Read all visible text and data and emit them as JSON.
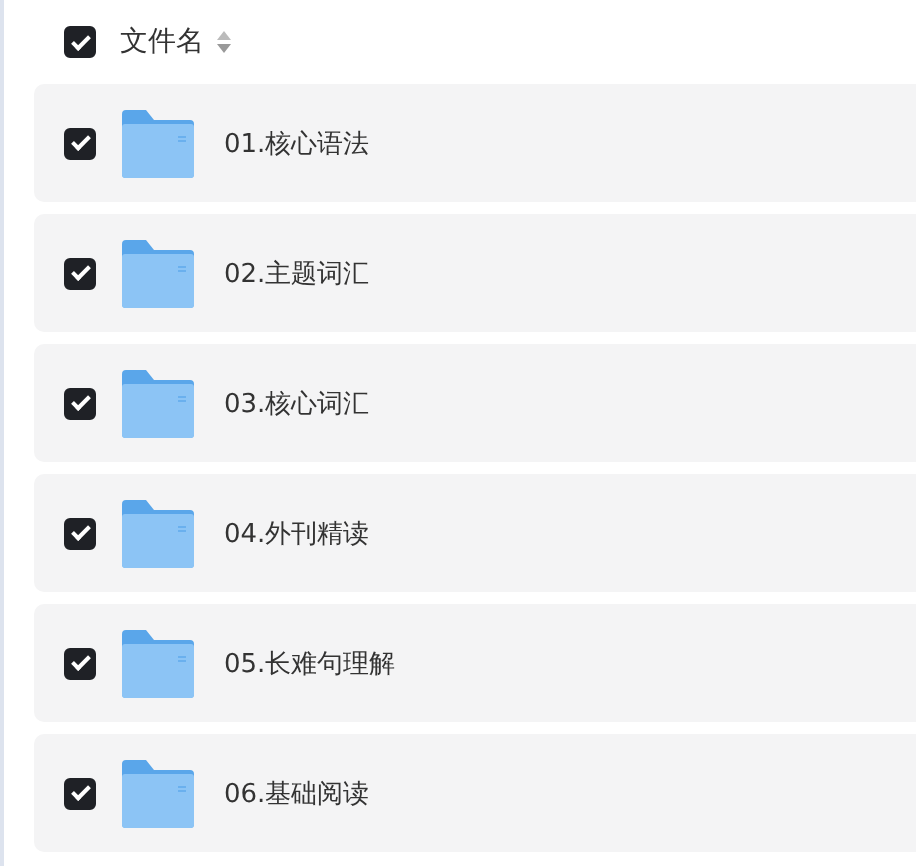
{
  "header": {
    "label": "文件名",
    "checked": true
  },
  "files": [
    {
      "name": "01.核心语法",
      "checked": true
    },
    {
      "name": "02.主题词汇",
      "checked": true
    },
    {
      "name": "03.核心词汇",
      "checked": true
    },
    {
      "name": "04.外刊精读",
      "checked": true
    },
    {
      "name": "05.长难句理解",
      "checked": true
    },
    {
      "name": "06.基础阅读",
      "checked": true
    }
  ]
}
